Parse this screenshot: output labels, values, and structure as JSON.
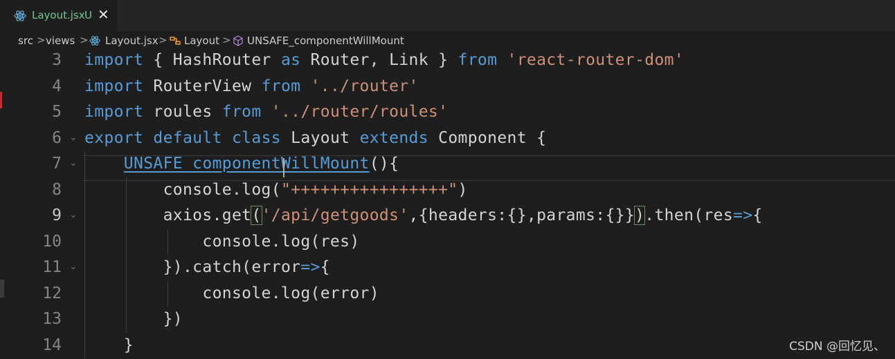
{
  "tab": {
    "filename": "Layout.jsx",
    "status": "U",
    "close_glyph": "✕",
    "icon": "react-icon",
    "color": "#73c991"
  },
  "breadcrumb": {
    "items": [
      "src",
      "views",
      "Layout.jsx",
      "Layout",
      "UNSAFE_componentWillMount"
    ],
    "separator": ">"
  },
  "editor": {
    "active_line": "9",
    "lines": [
      {
        "num": "3"
      },
      {
        "num": "4"
      },
      {
        "num": "5"
      },
      {
        "num": "6"
      },
      {
        "num": "7"
      },
      {
        "num": "8"
      },
      {
        "num": "9"
      },
      {
        "num": "10"
      },
      {
        "num": "11"
      },
      {
        "num": "12"
      },
      {
        "num": "13"
      },
      {
        "num": "14"
      }
    ],
    "tokens": {
      "l3": [
        "import",
        " { HashRouter ",
        "as",
        " Router, Link } ",
        "from",
        " ",
        "'react-router-dom'"
      ],
      "l4": [
        "import",
        " RouterView ",
        "from",
        " ",
        "'../router'"
      ],
      "l5": [
        "import",
        " roules ",
        "from",
        " ",
        "'../router/roules'"
      ],
      "l6": [
        "export",
        " ",
        "default",
        " ",
        "class",
        " Layout ",
        "extends",
        " Component {"
      ],
      "l7": [
        "    ",
        "UNSAFE_componentWillMount",
        "(){"
      ],
      "l8": [
        "        console.log(",
        "\"++++++++++++++++\"",
        ")"
      ],
      "l9": [
        "        axios.get",
        "(",
        "'/api/getgoods'",
        ",{headers:{},params:{}}",
        ")",
        ".then(res",
        "=>",
        "{"
      ],
      "l10": [
        "            console.log(res)"
      ],
      "l11": [
        "        }).catch(error",
        "=>",
        "{"
      ],
      "l12": [
        "            console.log(error)"
      ],
      "l13": [
        "        })"
      ],
      "l14": [
        "    }"
      ]
    }
  },
  "watermark": "CSDN @回忆见、",
  "colors": {
    "background": "#1e1e1e",
    "keyword": "#569cd6",
    "string": "#ce9178",
    "text": "#d4d4d4",
    "line_number": "#858585"
  }
}
